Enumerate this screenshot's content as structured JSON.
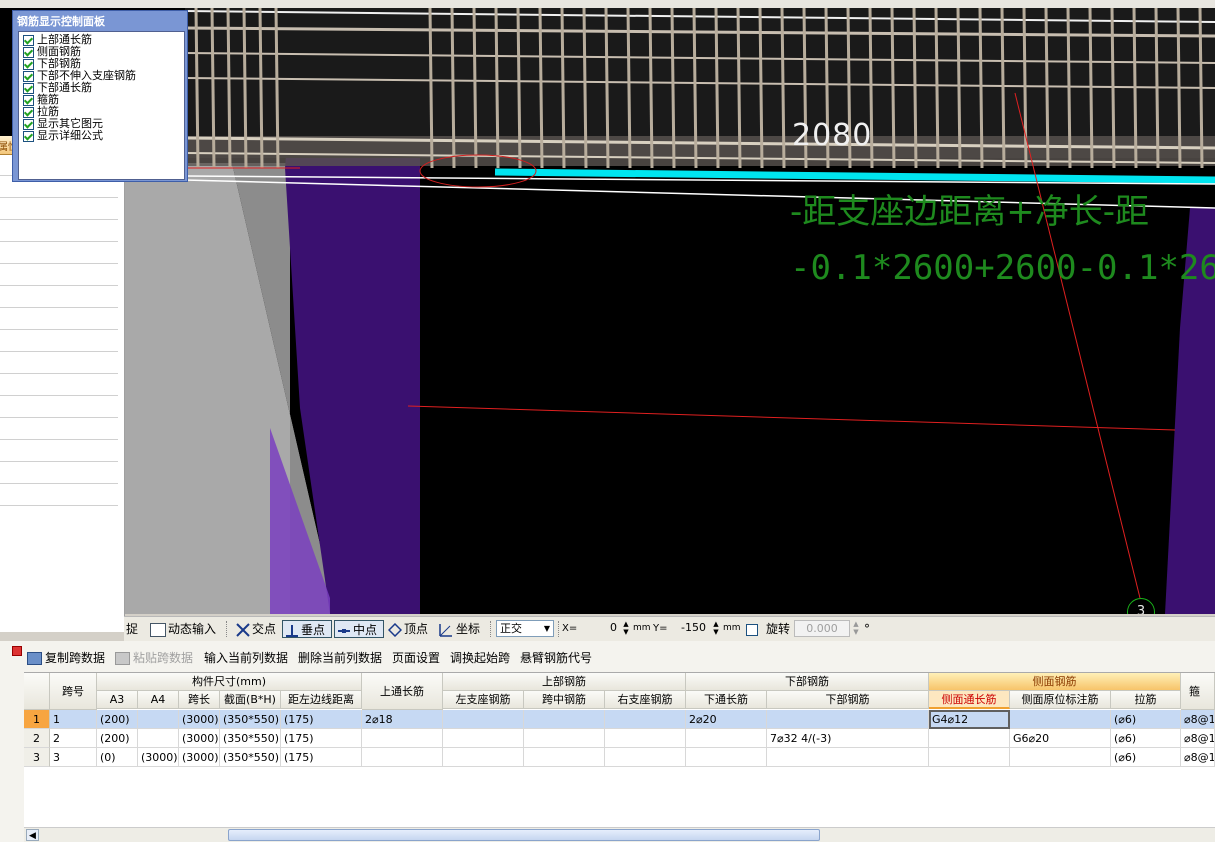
{
  "viewport": {
    "dimension_value": "2080",
    "formula_description": "-距支座边距离+净长-距",
    "formula_expression": "-0.1*2600+2600-0.1*26",
    "axis_label": "3"
  },
  "side_panel": {
    "header_text": "属性"
  },
  "control_panel": {
    "title": "钢筋显示控制面板",
    "items": [
      {
        "label": "上部通长筋",
        "checked": true
      },
      {
        "label": "侧面钢筋",
        "checked": true
      },
      {
        "label": "下部钢筋",
        "checked": true
      },
      {
        "label": "下部不伸入支座钢筋",
        "checked": true
      },
      {
        "label": "下部通长筋",
        "checked": true
      },
      {
        "label": "箍筋",
        "checked": true
      },
      {
        "label": "拉筋",
        "checked": true
      },
      {
        "label": "显示其它图元",
        "checked": true
      },
      {
        "label": "显示详细公式",
        "checked": true
      }
    ]
  },
  "snap_toolbar": {
    "orthogonal_partial": "捉",
    "dynamic_input": "动态输入",
    "intersection": "交点",
    "perpendicular": "垂点",
    "midpoint": "中点",
    "vertex": "顶点",
    "coordinate": "坐标",
    "mode_value": "正交",
    "x_label": "X=",
    "x_value": "0",
    "y_label": "Y=",
    "y_value": "-150",
    "unit": "mm",
    "rotate_label": "旋转",
    "rotate_value": "0.000",
    "degree": "°"
  },
  "table_toolbar": {
    "copy_span": "复制跨数据",
    "paste_span": "粘贴跨数据",
    "input_column": "输入当前列数据",
    "delete_column": "删除当前列数据",
    "page_setup": "页面设置",
    "swap_start": "调换起始跨",
    "cantilever_code": "悬臂钢筋代号"
  },
  "table": {
    "group_headers": {
      "span_no": "跨号",
      "dims": "构件尺寸(mm)",
      "top_long": "上通长筋",
      "top_rebar": "上部钢筋",
      "bottom_rebar": "下部钢筋",
      "side_rebar": "侧面钢筋",
      "stirrup": "箍"
    },
    "sub_headers": {
      "a3": "A3",
      "a4": "A4",
      "span_len": "跨长",
      "section": "截面(B*H)",
      "offset": "距左边线距离",
      "left_support": "左支座钢筋",
      "mid_span": "跨中钢筋",
      "right_support": "右支座钢筋",
      "bottom_long": "下通长筋",
      "bottom_rebar": "下部钢筋",
      "side_long": "侧面通长筋",
      "side_original": "侧面原位标注筋",
      "tie": "拉筋"
    },
    "rows": [
      {
        "rownum": "1",
        "span": "1",
        "a3": "(200)",
        "a4": "",
        "span_len": "(3000)",
        "section": "(350*550)",
        "offset": "(175)",
        "top_long": "2⌀18",
        "left_support": "",
        "mid_span": "",
        "right_support": "",
        "bottom_long": "2⌀20",
        "bottom_rebar": "",
        "side_long": "G4⌀12",
        "side_original": "",
        "tie": "(⌀6)",
        "stirrup": "⌀8@1"
      },
      {
        "rownum": "2",
        "span": "2",
        "a3": "(200)",
        "a4": "",
        "span_len": "(3000)",
        "section": "(350*550)",
        "offset": "(175)",
        "top_long": "",
        "left_support": "",
        "mid_span": "",
        "right_support": "",
        "bottom_long": "",
        "bottom_rebar": "7⌀32 4/(-3)",
        "side_long": "",
        "side_original": "G6⌀20",
        "tie": "(⌀6)",
        "stirrup": "⌀8@1"
      },
      {
        "rownum": "3",
        "span": "3",
        "a3": "(0)",
        "a4": "(3000)",
        "span_len": "(3000)",
        "section": "(350*550)",
        "offset": "(175)",
        "top_long": "",
        "left_support": "",
        "mid_span": "",
        "right_support": "",
        "bottom_long": "",
        "bottom_rebar": "",
        "side_long": "",
        "side_original": "",
        "tie": "(⌀6)",
        "stirrup": "⌀8@1"
      }
    ]
  },
  "colors": {
    "viewport_bg": "#000000",
    "column_purple": "#4a1a8a",
    "formula_green": "#1e8a1e",
    "highlight_cyan": "#00e5f0",
    "selection_blue": "#c6d9f3",
    "header_orange": "#f7c46a"
  }
}
